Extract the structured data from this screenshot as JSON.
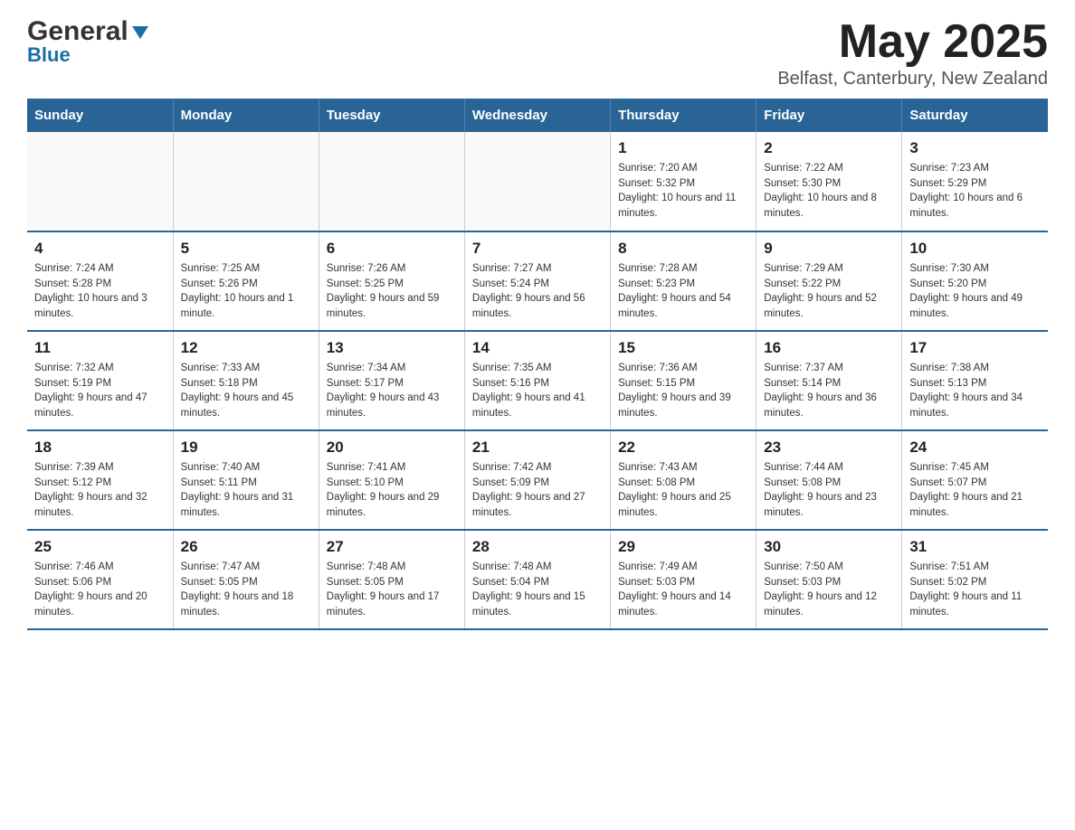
{
  "header": {
    "logo_general": "General",
    "logo_blue": "Blue",
    "month_title": "May 2025",
    "location": "Belfast, Canterbury, New Zealand"
  },
  "days_of_week": [
    "Sunday",
    "Monday",
    "Tuesday",
    "Wednesday",
    "Thursday",
    "Friday",
    "Saturday"
  ],
  "weeks": [
    [
      {
        "day": "",
        "info": ""
      },
      {
        "day": "",
        "info": ""
      },
      {
        "day": "",
        "info": ""
      },
      {
        "day": "",
        "info": ""
      },
      {
        "day": "1",
        "info": "Sunrise: 7:20 AM\nSunset: 5:32 PM\nDaylight: 10 hours and 11 minutes."
      },
      {
        "day": "2",
        "info": "Sunrise: 7:22 AM\nSunset: 5:30 PM\nDaylight: 10 hours and 8 minutes."
      },
      {
        "day": "3",
        "info": "Sunrise: 7:23 AM\nSunset: 5:29 PM\nDaylight: 10 hours and 6 minutes."
      }
    ],
    [
      {
        "day": "4",
        "info": "Sunrise: 7:24 AM\nSunset: 5:28 PM\nDaylight: 10 hours and 3 minutes."
      },
      {
        "day": "5",
        "info": "Sunrise: 7:25 AM\nSunset: 5:26 PM\nDaylight: 10 hours and 1 minute."
      },
      {
        "day": "6",
        "info": "Sunrise: 7:26 AM\nSunset: 5:25 PM\nDaylight: 9 hours and 59 minutes."
      },
      {
        "day": "7",
        "info": "Sunrise: 7:27 AM\nSunset: 5:24 PM\nDaylight: 9 hours and 56 minutes."
      },
      {
        "day": "8",
        "info": "Sunrise: 7:28 AM\nSunset: 5:23 PM\nDaylight: 9 hours and 54 minutes."
      },
      {
        "day": "9",
        "info": "Sunrise: 7:29 AM\nSunset: 5:22 PM\nDaylight: 9 hours and 52 minutes."
      },
      {
        "day": "10",
        "info": "Sunrise: 7:30 AM\nSunset: 5:20 PM\nDaylight: 9 hours and 49 minutes."
      }
    ],
    [
      {
        "day": "11",
        "info": "Sunrise: 7:32 AM\nSunset: 5:19 PM\nDaylight: 9 hours and 47 minutes."
      },
      {
        "day": "12",
        "info": "Sunrise: 7:33 AM\nSunset: 5:18 PM\nDaylight: 9 hours and 45 minutes."
      },
      {
        "day": "13",
        "info": "Sunrise: 7:34 AM\nSunset: 5:17 PM\nDaylight: 9 hours and 43 minutes."
      },
      {
        "day": "14",
        "info": "Sunrise: 7:35 AM\nSunset: 5:16 PM\nDaylight: 9 hours and 41 minutes."
      },
      {
        "day": "15",
        "info": "Sunrise: 7:36 AM\nSunset: 5:15 PM\nDaylight: 9 hours and 39 minutes."
      },
      {
        "day": "16",
        "info": "Sunrise: 7:37 AM\nSunset: 5:14 PM\nDaylight: 9 hours and 36 minutes."
      },
      {
        "day": "17",
        "info": "Sunrise: 7:38 AM\nSunset: 5:13 PM\nDaylight: 9 hours and 34 minutes."
      }
    ],
    [
      {
        "day": "18",
        "info": "Sunrise: 7:39 AM\nSunset: 5:12 PM\nDaylight: 9 hours and 32 minutes."
      },
      {
        "day": "19",
        "info": "Sunrise: 7:40 AM\nSunset: 5:11 PM\nDaylight: 9 hours and 31 minutes."
      },
      {
        "day": "20",
        "info": "Sunrise: 7:41 AM\nSunset: 5:10 PM\nDaylight: 9 hours and 29 minutes."
      },
      {
        "day": "21",
        "info": "Sunrise: 7:42 AM\nSunset: 5:09 PM\nDaylight: 9 hours and 27 minutes."
      },
      {
        "day": "22",
        "info": "Sunrise: 7:43 AM\nSunset: 5:08 PM\nDaylight: 9 hours and 25 minutes."
      },
      {
        "day": "23",
        "info": "Sunrise: 7:44 AM\nSunset: 5:08 PM\nDaylight: 9 hours and 23 minutes."
      },
      {
        "day": "24",
        "info": "Sunrise: 7:45 AM\nSunset: 5:07 PM\nDaylight: 9 hours and 21 minutes."
      }
    ],
    [
      {
        "day": "25",
        "info": "Sunrise: 7:46 AM\nSunset: 5:06 PM\nDaylight: 9 hours and 20 minutes."
      },
      {
        "day": "26",
        "info": "Sunrise: 7:47 AM\nSunset: 5:05 PM\nDaylight: 9 hours and 18 minutes."
      },
      {
        "day": "27",
        "info": "Sunrise: 7:48 AM\nSunset: 5:05 PM\nDaylight: 9 hours and 17 minutes."
      },
      {
        "day": "28",
        "info": "Sunrise: 7:48 AM\nSunset: 5:04 PM\nDaylight: 9 hours and 15 minutes."
      },
      {
        "day": "29",
        "info": "Sunrise: 7:49 AM\nSunset: 5:03 PM\nDaylight: 9 hours and 14 minutes."
      },
      {
        "day": "30",
        "info": "Sunrise: 7:50 AM\nSunset: 5:03 PM\nDaylight: 9 hours and 12 minutes."
      },
      {
        "day": "31",
        "info": "Sunrise: 7:51 AM\nSunset: 5:02 PM\nDaylight: 9 hours and 11 minutes."
      }
    ]
  ]
}
